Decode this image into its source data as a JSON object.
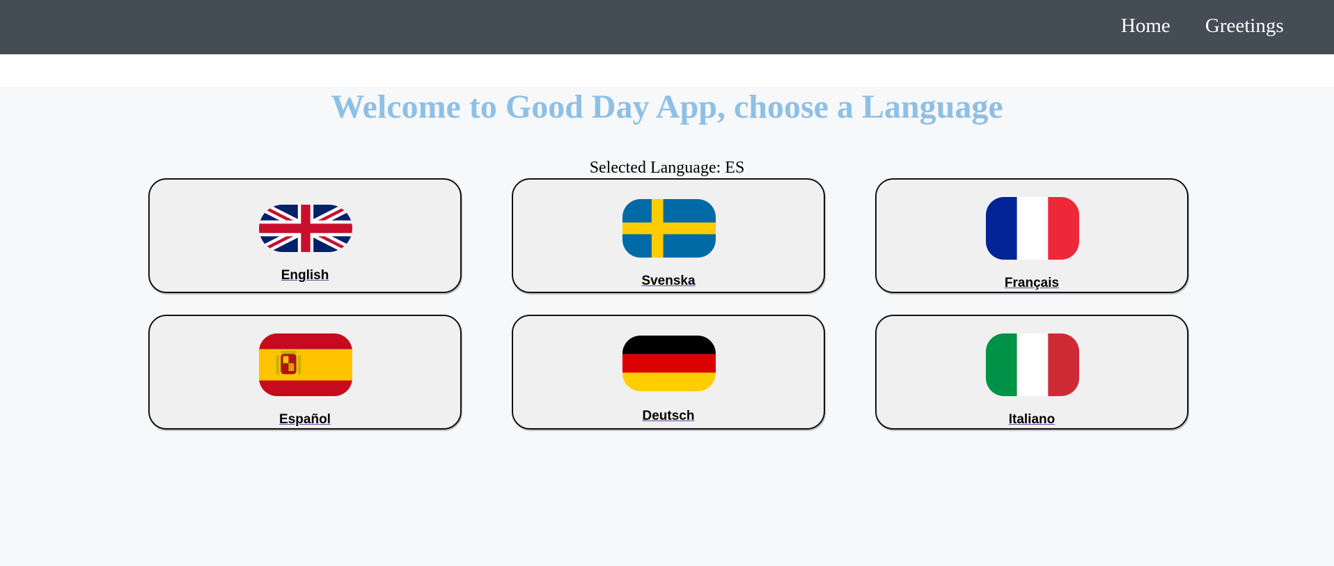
{
  "nav": {
    "home_label": "Home",
    "greetings_label": "Greetings"
  },
  "main": {
    "title": "Welcome to Good Day App, choose a Language",
    "selected_prefix": "Selected Language:",
    "selected_code": "ES"
  },
  "languages": [
    {
      "label": "English",
      "flag_icon": "uk-flag-icon"
    },
    {
      "label": "Svenska",
      "flag_icon": "sweden-flag-icon"
    },
    {
      "label": "Français",
      "flag_icon": "france-flag-icon"
    },
    {
      "label": "Español",
      "flag_icon": "spain-flag-icon"
    },
    {
      "label": "Deutsch",
      "flag_icon": "germany-flag-icon"
    },
    {
      "label": "Italiano",
      "flag_icon": "italy-flag-icon"
    }
  ],
  "colors": {
    "navbar": "#444c56",
    "title": "#8ec0e6",
    "card_bg": "#f0f0f0",
    "page_bg": "#f7f8f9"
  }
}
